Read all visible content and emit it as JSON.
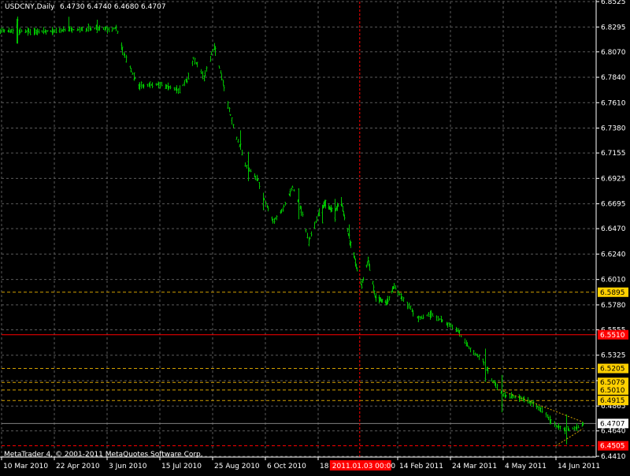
{
  "header": {
    "symbol_label": "USDCNY,Daily",
    "ohlc_label": "6.4730 6.4740 6.4680 6.4707"
  },
  "footer": {
    "copyright": "MetaTrader 4, © 2001-2011 MetaQuotes Software Corp."
  },
  "colors": {
    "background": "#000000",
    "grid": "#5a5a5a",
    "bars": "#00c000",
    "axis_text": "#ffffff",
    "horizontal_level": "#d2a000",
    "red_level": "#ff0000",
    "current_price_line": "#808080",
    "crosshair": "#ff0000"
  },
  "chart_data": {
    "type": "ohlc-bar",
    "y_ticks": [
      "6.8525",
      "6.8295",
      "6.8070",
      "6.7840",
      "6.7610",
      "6.7380",
      "6.7155",
      "6.6925",
      "6.6695",
      "6.6470",
      "6.6240",
      "6.6010",
      "6.5780",
      "6.5555",
      "6.5325",
      "6.5095",
      "6.4865",
      "6.4640",
      "6.4410"
    ],
    "ylim": [
      6.441,
      6.8525
    ],
    "x_ticks": [
      {
        "label": "10 Mar 2010",
        "date": "2010-03-10"
      },
      {
        "label": "22 Apr 2010",
        "date": "2010-04-22"
      },
      {
        "label": "3 Jun 2010",
        "date": "2010-06-03"
      },
      {
        "label": "15 Jul 2010",
        "date": "2010-07-15"
      },
      {
        "label": "25 Aug 2010",
        "date": "2010-08-25"
      },
      {
        "label": "6 Oct 2010",
        "date": "2010-10-06"
      },
      {
        "label": "18 Nov 2010",
        "date": "2010-11-18"
      },
      {
        "label": "14 Feb 2011",
        "date": "2011-02-14"
      },
      {
        "label": "24 Mar 2011",
        "date": "2011-03-24"
      },
      {
        "label": "4 May 2011",
        "date": "2011-05-04"
      },
      {
        "label": "14 Jun 2011",
        "date": "2011-06-14"
      }
    ],
    "crosshair": {
      "label": "2011.01.03 00:00",
      "date": "2011-01-03",
      "price": 6.551,
      "price_label": "6.5510"
    },
    "current_price": {
      "value": 6.4707,
      "label": "6.4707"
    },
    "horizontal_levels": [
      {
        "value": 6.5895,
        "label": "6.5895",
        "style": "dashed-yellow"
      },
      {
        "value": 6.5205,
        "label": "6.5205",
        "style": "dashed-yellow"
      },
      {
        "value": 6.5079,
        "label": "6.5079",
        "style": "dashed-yellow"
      },
      {
        "value": 6.501,
        "label": "6.5010",
        "style": "dashed-yellow"
      },
      {
        "value": 6.4915,
        "label": "6.4915",
        "style": "dashed-yellow"
      },
      {
        "value": 6.4505,
        "label": "6.4505",
        "style": "dashed-red"
      }
    ],
    "trendlines": [
      {
        "from": {
          "date": "2011-05-04",
          "price": 6.5
        },
        "to": {
          "date": "2011-07-05",
          "price": 6.472
        }
      },
      {
        "from": {
          "date": "2011-06-14",
          "price": 6.4505
        },
        "to": {
          "date": "2011-07-05",
          "price": 6.466
        }
      }
    ],
    "series_anchors": [
      {
        "date": "2010-03-08",
        "price": 6.826
      },
      {
        "date": "2010-04-15",
        "price": 6.8255
      },
      {
        "date": "2010-05-30",
        "price": 6.8285
      },
      {
        "date": "2010-06-05",
        "price": 6.827
      },
      {
        "date": "2010-06-10",
        "price": 6.829
      },
      {
        "date": "2010-06-15",
        "price": 6.808
      },
      {
        "date": "2010-06-22",
        "price": 6.79
      },
      {
        "date": "2010-06-28",
        "price": 6.776
      },
      {
        "date": "2010-07-15",
        "price": 6.778
      },
      {
        "date": "2010-07-30",
        "price": 6.772
      },
      {
        "date": "2010-08-05",
        "price": 6.782
      },
      {
        "date": "2010-08-10",
        "price": 6.801
      },
      {
        "date": "2010-08-18",
        "price": 6.784
      },
      {
        "date": "2010-08-26",
        "price": 6.812
      },
      {
        "date": "2010-09-01",
        "price": 6.784
      },
      {
        "date": "2010-09-10",
        "price": 6.74
      },
      {
        "date": "2010-09-20",
        "price": 6.705
      },
      {
        "date": "2010-09-30",
        "price": 6.691
      },
      {
        "date": "2010-10-06",
        "price": 6.67
      },
      {
        "date": "2010-10-12",
        "price": 6.653
      },
      {
        "date": "2010-10-20",
        "price": 6.665
      },
      {
        "date": "2010-10-28",
        "price": 6.685
      },
      {
        "date": "2010-11-05",
        "price": 6.66
      },
      {
        "date": "2010-11-10",
        "price": 6.635
      },
      {
        "date": "2010-11-18",
        "price": 6.66
      },
      {
        "date": "2010-11-25",
        "price": 6.67
      },
      {
        "date": "2010-12-05",
        "price": 6.662
      },
      {
        "date": "2010-12-13",
        "price": 6.672
      },
      {
        "date": "2010-12-20",
        "price": 6.645
      },
      {
        "date": "2010-12-28",
        "price": 6.62
      },
      {
        "date": "2011-01-05",
        "price": 6.595
      },
      {
        "date": "2011-01-12",
        "price": 6.62
      },
      {
        "date": "2011-01-20",
        "price": 6.585
      },
      {
        "date": "2011-02-01",
        "price": 6.58
      },
      {
        "date": "2011-02-10",
        "price": 6.595
      },
      {
        "date": "2011-02-20",
        "price": 6.58
      },
      {
        "date": "2011-03-01",
        "price": 6.565
      },
      {
        "date": "2011-03-10",
        "price": 6.57
      },
      {
        "date": "2011-03-20",
        "price": 6.562
      },
      {
        "date": "2011-03-30",
        "price": 6.554
      },
      {
        "date": "2011-04-08",
        "price": 6.538
      },
      {
        "date": "2011-04-18",
        "price": 6.528
      },
      {
        "date": "2011-04-25",
        "price": 6.51
      },
      {
        "date": "2011-05-04",
        "price": 6.496
      },
      {
        "date": "2011-05-12",
        "price": 6.495
      },
      {
        "date": "2011-05-20",
        "price": 6.493
      },
      {
        "date": "2011-05-28",
        "price": 6.488
      },
      {
        "date": "2011-06-05",
        "price": 6.48
      },
      {
        "date": "2011-06-12",
        "price": 6.47
      },
      {
        "date": "2011-06-20",
        "price": 6.465
      },
      {
        "date": "2011-06-28",
        "price": 6.466
      },
      {
        "date": "2011-07-05",
        "price": 6.4707
      }
    ]
  }
}
